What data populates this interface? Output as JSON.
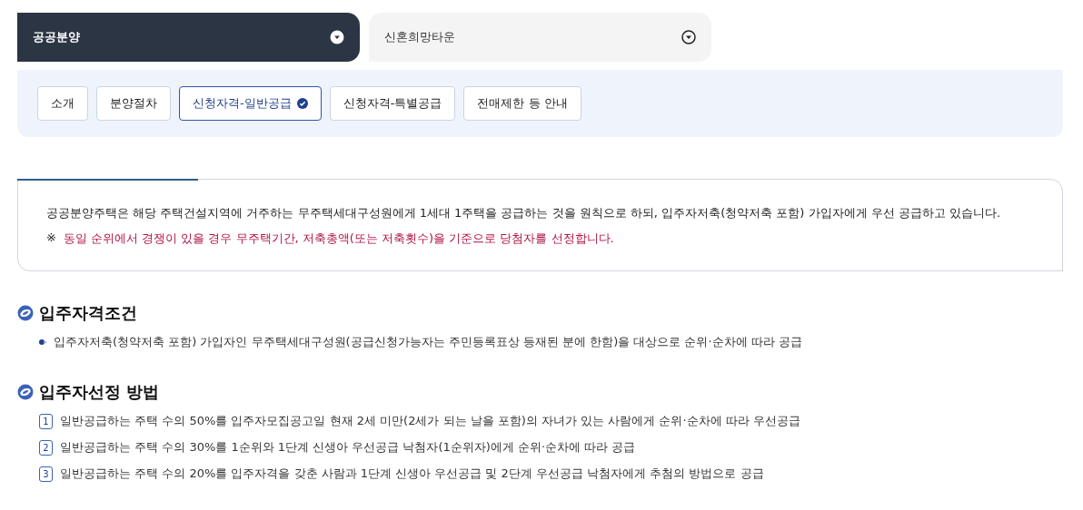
{
  "category_selects": [
    {
      "label": "공공분양",
      "selected": true
    },
    {
      "label": "신혼희망타운",
      "selected": false
    }
  ],
  "tabs": [
    {
      "label": "소개",
      "selected": false
    },
    {
      "label": "분양절차",
      "selected": false
    },
    {
      "label": "신청자격-일반공급",
      "selected": true
    },
    {
      "label": "신청자격-특별공급",
      "selected": false
    },
    {
      "label": "전매제한 등 안내",
      "selected": false
    }
  ],
  "notice": {
    "text": "공공분양주택은 해당 주택건설지역에 거주하는 무주택세대구성원에게 1세대 1주택을 공급하는 것을 원칙으로 하되, 입주자저축(청약저축 포함) 가입자에게 우선 공급하고 있습니다.",
    "note_mark": "※",
    "note": "동일 순위에서 경쟁이 있을 경우 무주택기간, 저축총액(또는 저축횟수)을 기준으로 당첨자를 선정합니다."
  },
  "sections": [
    {
      "title": "입주자격조건",
      "kind": "bullets",
      "items": [
        {
          "text": "입주자저축(청약저축 포함) 가입자인 무주택세대구성원(공급신청가능자는 주민등록표상 등재된 분에 한함)을 대상으로 순위·순차에 따라 공급"
        }
      ]
    },
    {
      "title": "입주자선정 방법",
      "kind": "numbered",
      "items": [
        {
          "number": "1",
          "text": "일반공급하는 주택 수의 50%를 입주자모집공고일 현재 2세 미만(2세가 되는 날을 포함)의 자녀가 있는 사람에게 순위·순차에 따라 우선공급"
        },
        {
          "number": "2",
          "text": "일반공급하는 주택 수의 30%를 1순위와 1단계 신생아 우선공급 낙첨자(1순위자)에게 순위·순차에 따라 공급"
        },
        {
          "number": "3",
          "text": "일반공급하는 주택 수의 20%를 입주자격을 갖춘 사람과 1단계 신생아 우선공급 및 2단계 우선공급 낙첨자에게 추첨의 방법으로 공급"
        }
      ]
    }
  ]
}
